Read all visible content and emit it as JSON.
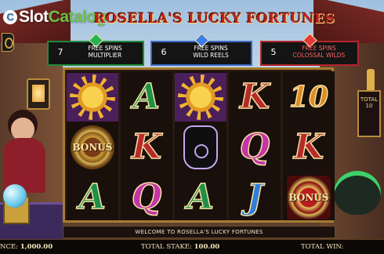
{
  "watermark": {
    "brand_a": "Slot",
    "brand_b": "Catalog",
    "mark": "C"
  },
  "title": "ROSELLA'S LUCKY FORTUNES",
  "banners": [
    {
      "count": "7",
      "line1": "FREE SPINS",
      "line2": "MULTIPLIER"
    },
    {
      "count": "6",
      "line1": "FREE SPINS",
      "line2": "WILD REELS"
    },
    {
      "count": "5",
      "line1": "FREE SPINS",
      "line2": "COLOSSAL WILDS"
    }
  ],
  "reels": [
    [
      "sun",
      "bonus",
      "A"
    ],
    [
      "A",
      "K",
      "Q"
    ],
    [
      "sun",
      "palm",
      "A"
    ],
    [
      "K",
      "Q",
      "J"
    ],
    [
      "10",
      "K",
      "bonus-red"
    ]
  ],
  "bonus_label": "BONUS",
  "side_panel": {
    "line1": "TOTAL",
    "line2": "10"
  },
  "welcome_text": "WELCOME TO ROSELLA'S LUCKY FORTUNES",
  "status": {
    "balance_label": "NCE:",
    "balance_value": "1,000.00",
    "stake_label": "TOTAL STAKE:",
    "stake_value": "100.00",
    "win_label": "TOTAL WIN:",
    "win_value": ""
  },
  "colors": {
    "A": "#1f8f48",
    "K": "#b82a2a",
    "Q": "#c533a8",
    "J": "#2f7fd9",
    "ten": "#e08a23",
    "frame": "#a57b2d"
  }
}
